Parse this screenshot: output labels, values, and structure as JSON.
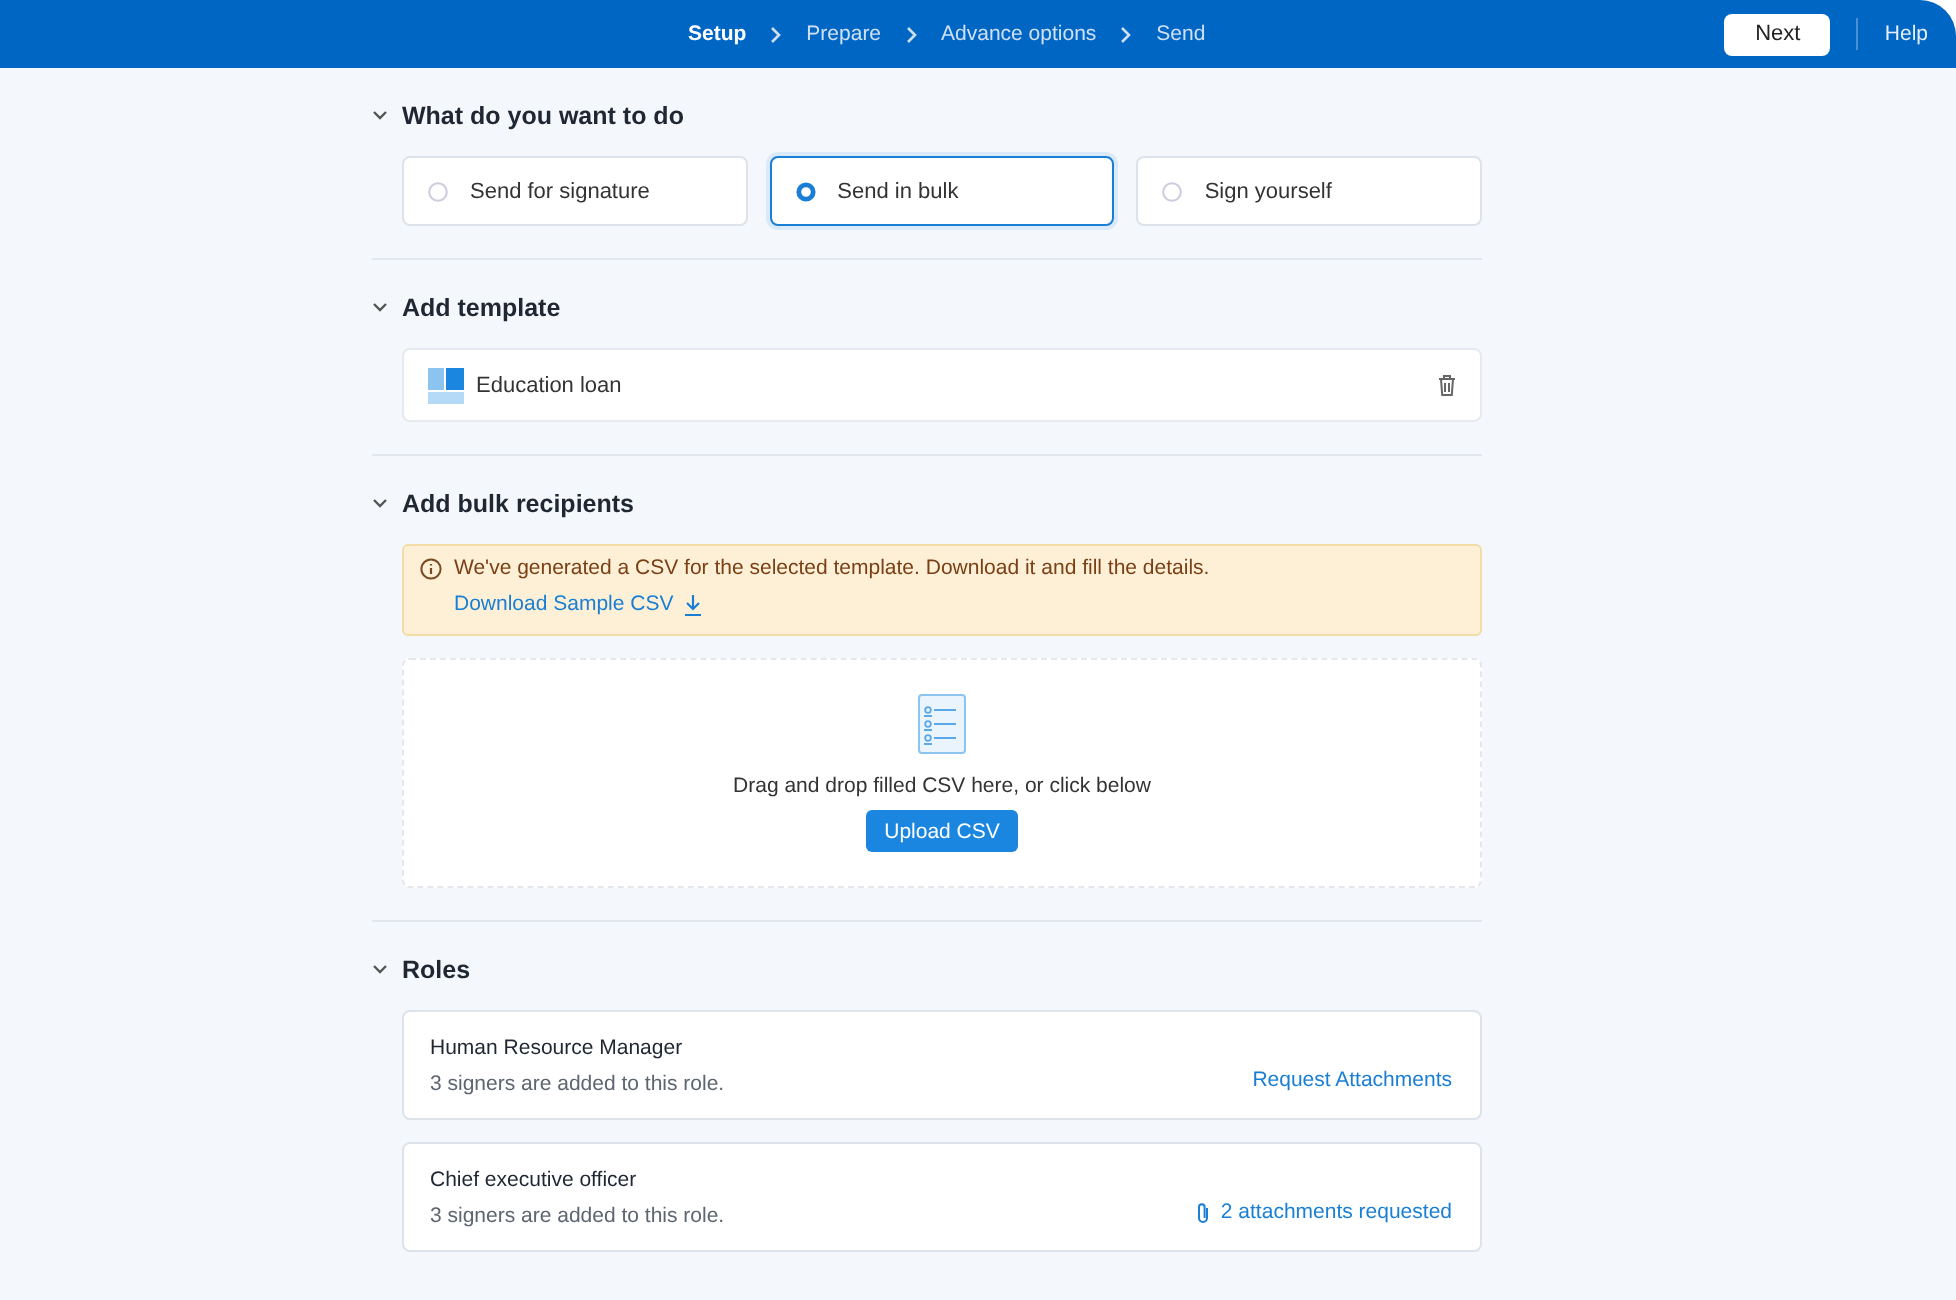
{
  "header": {
    "steps": [
      {
        "label": "Setup",
        "selected": true
      },
      {
        "label": "Prepare",
        "selected": false
      },
      {
        "label": "Advance options",
        "selected": false
      },
      {
        "label": "Send",
        "selected": false
      }
    ],
    "next_button": "Next",
    "help": "Help"
  },
  "sections": [
    {
      "kind": "options",
      "title": "What do you want to do",
      "expanded": true,
      "options": [
        {
          "label": "Send for signature",
          "selected": false
        },
        {
          "label": "Send in bulk",
          "selected": true
        },
        {
          "label": "Sign yourself",
          "selected": false
        }
      ]
    },
    {
      "kind": "template",
      "title": "Add template",
      "expanded": true,
      "template": {
        "name": "Education loan"
      }
    },
    {
      "kind": "recipients",
      "title": "Add bulk recipients",
      "expanded": true,
      "alert": {
        "message": "We've generated a CSV for the selected template. Download it and fill the details.",
        "link": "Download Sample CSV"
      },
      "dropzone": {
        "text": "Drag and drop filled CSV here, or click below",
        "button": "Upload CSV"
      }
    },
    {
      "kind": "roles",
      "title": "Roles",
      "expanded": true,
      "roles": [
        {
          "name": "Human Resource Manager",
          "note": "3 signers are added to this role.",
          "action": {
            "kind": "request",
            "label": "Request Attachments"
          }
        },
        {
          "name": "Chief executive officer",
          "note": "3 signers are added to this role.",
          "action": {
            "kind": "attachments",
            "label": "2 attachments requested"
          }
        }
      ]
    }
  ]
}
